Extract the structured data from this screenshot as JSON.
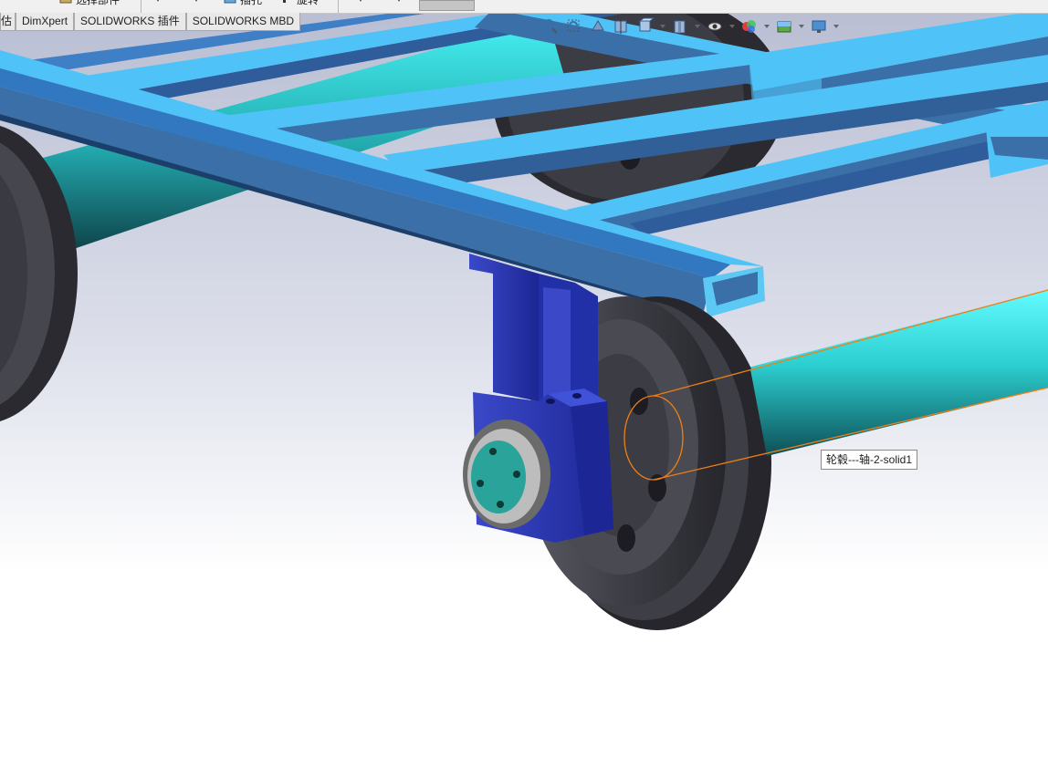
{
  "toolbar": {
    "insert_components_label": "选择部件",
    "feature_label": "插孔",
    "rotate_label": "旋转"
  },
  "tabs": [
    "估",
    "DimXpert",
    "SOLIDWORKS 插件",
    "SOLIDWORKS MBD"
  ],
  "view_toolbar": {
    "icons": [
      "zoom-to-fit-icon",
      "zoom-to-area-icon",
      "previous-view-icon",
      "section-view-icon",
      "view-orientation-icon",
      "display-style-icon",
      "hide-show-items-icon",
      "edit-appearance-icon",
      "apply-scene-icon",
      "view-settings-icon"
    ]
  },
  "viewport": {
    "tooltip": "轮毂---轴-2-solid1",
    "colors": {
      "frame": "#4fc3f7",
      "frame_dark": "#3a6fa8",
      "shaft": "#3ff0ee",
      "wheel": "#3c3c44",
      "bracket": "#2733b8",
      "hub": "#2aa39a",
      "highlight": "#f07f14"
    }
  }
}
